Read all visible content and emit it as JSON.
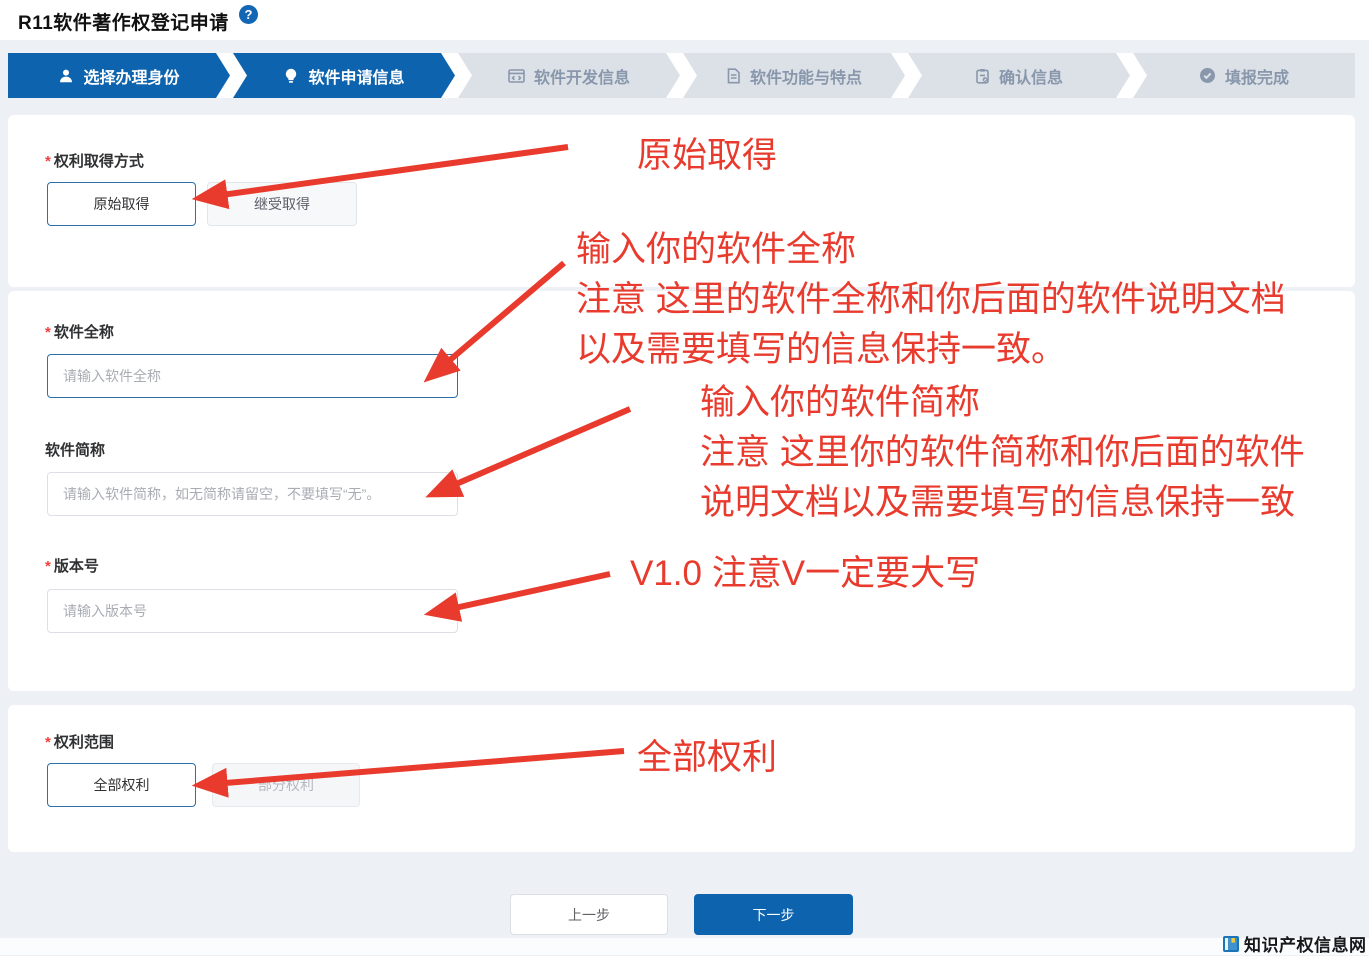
{
  "page": {
    "title": "R11软件著作权登记申请",
    "help_icon": "?"
  },
  "ui": {
    "required_marker": "*"
  },
  "steps": [
    {
      "label": "选择办理身份",
      "icon": "user-icon",
      "state": "active"
    },
    {
      "label": "软件申请信息",
      "icon": "bulb-icon",
      "state": "active"
    },
    {
      "label": "软件开发信息",
      "icon": "code-window-icon",
      "state": "inactive"
    },
    {
      "label": "软件功能与特点",
      "icon": "document-icon",
      "state": "inactive"
    },
    {
      "label": "确认信息",
      "icon": "clipboard-check-icon",
      "state": "inactive"
    },
    {
      "label": "填报完成",
      "icon": "check-circle-icon",
      "state": "inactive"
    }
  ],
  "form": {
    "acquisition": {
      "label": "权利取得方式",
      "required": true,
      "options": [
        {
          "label": "原始取得",
          "selected": true
        },
        {
          "label": "继受取得",
          "selected": false
        }
      ]
    },
    "full_name": {
      "label": "软件全称",
      "required": true,
      "value": "",
      "placeholder": "请输入软件全称"
    },
    "short_name": {
      "label": "软件简称",
      "required": false,
      "value": "",
      "placeholder": "请输入软件简称，如无简称请留空，不要填写“无”。"
    },
    "version": {
      "label": "版本号",
      "required": true,
      "value": "",
      "placeholder": "请输入版本号"
    },
    "rights_scope": {
      "label": "权利范围",
      "required": true,
      "options": [
        {
          "label": "全部权利",
          "selected": true
        },
        {
          "label": "部分权利",
          "selected": false
        }
      ]
    }
  },
  "footer_nav": {
    "prev_label": "上一步",
    "next_label": "下一步"
  },
  "watermark": {
    "site_name": "知识产权信息网"
  },
  "annotations": {
    "color": "#e83b2e",
    "items": [
      {
        "lines": [
          "原始取得"
        ]
      },
      {
        "lines": [
          "输入你的软件全称",
          "注意 这里的软件全称和你后面的软件说明文档",
          "以及需要填写的信息保持一致。"
        ]
      },
      {
        "lines": [
          "输入你的软件简称",
          "注意 这里你的软件简称和你后面的软件",
          "说明文档以及需要填写的信息保持一致"
        ]
      },
      {
        "lines": [
          "V1.0 注意V一定要大写"
        ]
      },
      {
        "lines": [
          "全部权利"
        ]
      }
    ]
  },
  "colors": {
    "accent_blue": "#0d63ae",
    "annotation_red": "#e83b2e",
    "page_bg": "#edf1f6"
  }
}
